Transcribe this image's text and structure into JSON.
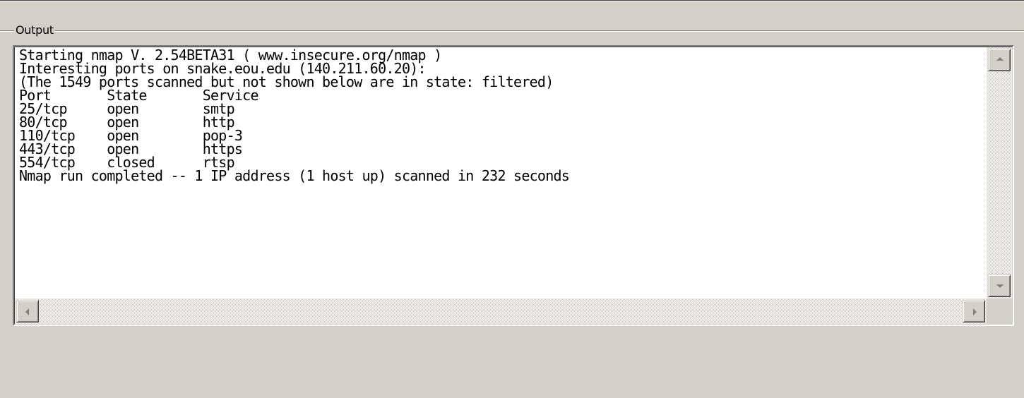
{
  "group": {
    "label": "Output"
  },
  "output": {
    "lines": [
      "Starting nmap V. 2.54BETA31 ( www.insecure.org/nmap )",
      "Interesting ports on snake.eou.edu (140.211.60.20):",
      "(The 1549 ports scanned but not shown below are in state: filtered)",
      "Port       State       Service",
      "25/tcp     open        smtp",
      "80/tcp     open        http",
      "110/tcp    open        pop-3",
      "443/tcp    open        https",
      "554/tcp    closed      rtsp",
      "Nmap run completed -- 1 IP address (1 host up) scanned in 232 seconds"
    ]
  },
  "scrollbars": {
    "up_icon": "scroll-up-arrow",
    "down_icon": "scroll-down-arrow",
    "left_icon": "scroll-left-arrow",
    "right_icon": "scroll-right-arrow"
  },
  "colors": {
    "window_bg": "#d4d0c8",
    "text_bg": "#ffffff",
    "text": "#000000",
    "arrow_disabled": "#808080"
  }
}
